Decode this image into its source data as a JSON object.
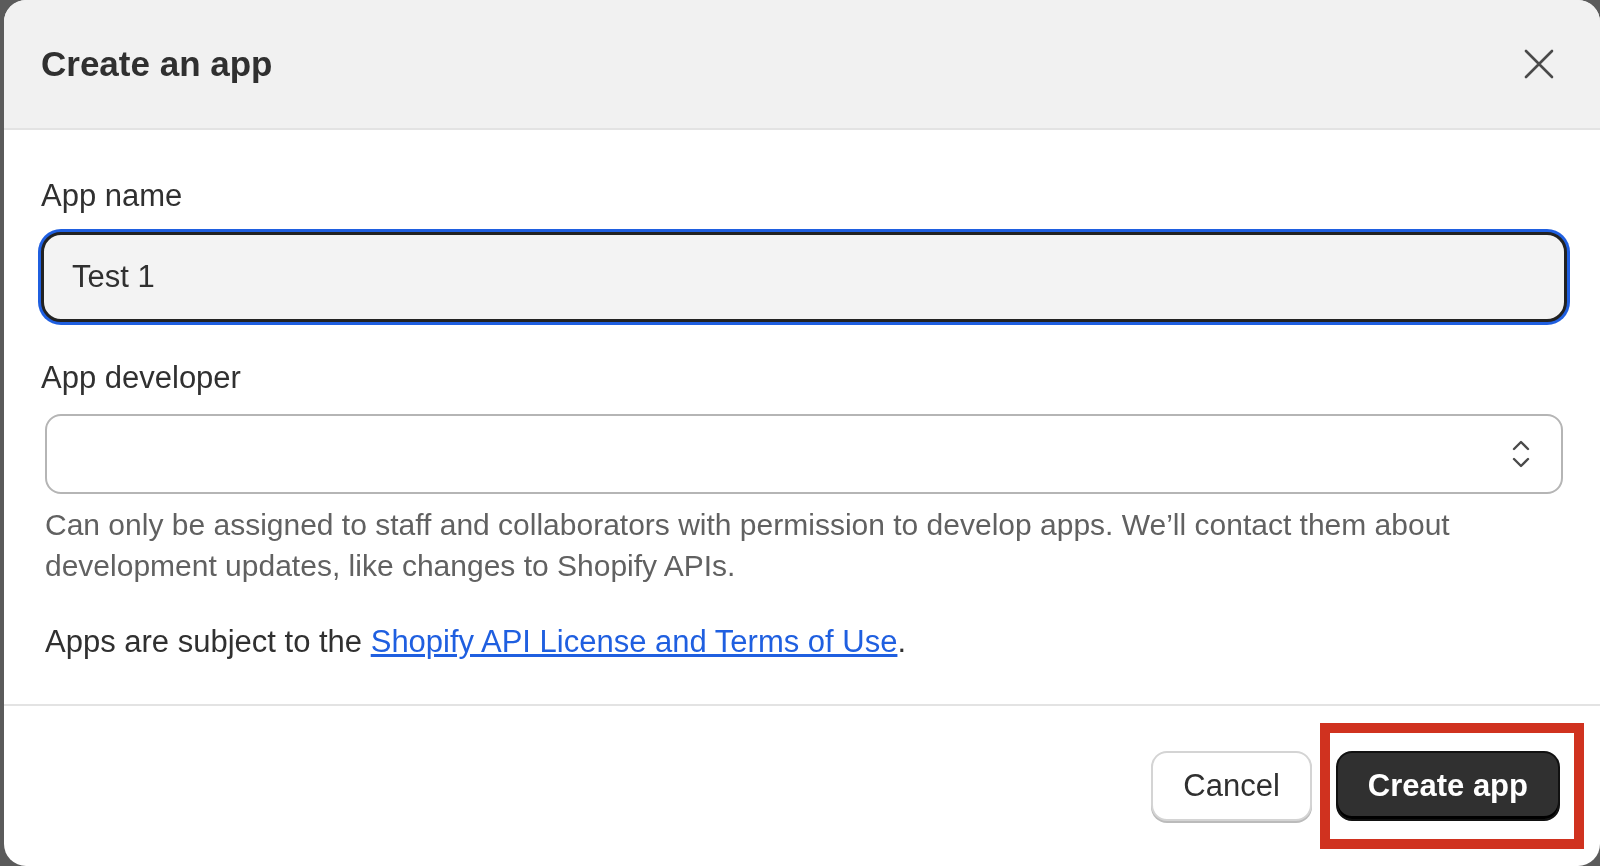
{
  "dialog": {
    "title": "Create an app"
  },
  "fields": [
    {
      "kind": "text",
      "label": "App name",
      "value": "Test 1",
      "focused": true
    },
    {
      "kind": "select",
      "label": "App developer",
      "focused": false,
      "help": "Can only be assigned to staff and collaborators with permission to develop apps. We’ll contact them about development updates, like changes to Shopify APIs."
    }
  ],
  "terms": {
    "before": "Apps are subject to the ",
    "link": "Shopify API License and Terms of Use",
    "after": "."
  },
  "buttons": [
    {
      "label": "Cancel",
      "kind": "secondary"
    },
    {
      "label": "Create app",
      "kind": "primary"
    }
  ]
}
